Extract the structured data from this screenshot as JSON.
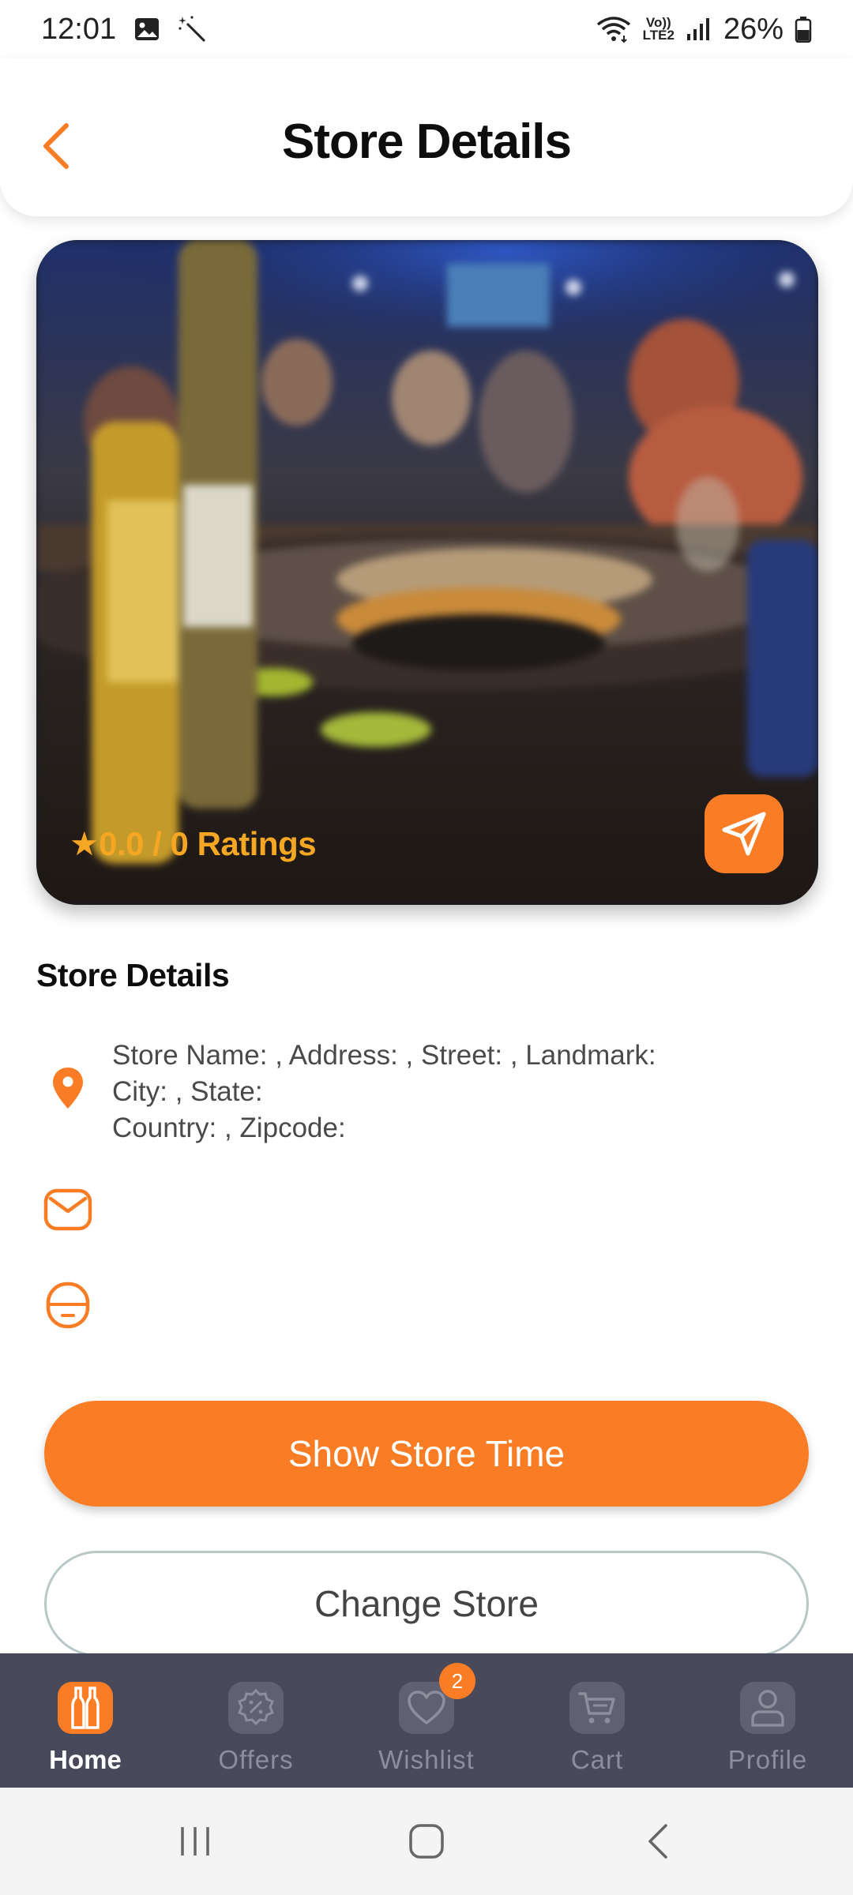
{
  "status_bar": {
    "time": "12:01",
    "volte_label_top": "Vo))",
    "volte_label_bottom": "LTE2",
    "battery": "26%",
    "icons": [
      "gallery-icon",
      "magic-wand-icon",
      "wifi-icon",
      "signal-icon",
      "battery-icon"
    ]
  },
  "header": {
    "title": "Store Details",
    "back_icon": "chevron-left-icon"
  },
  "hero": {
    "rating_text": "★0.0 / 0 Ratings",
    "share_icon": "send-icon"
  },
  "details": {
    "section_title": "Store Details",
    "address_lines": [
      "Store Name: , Address: , Street: , Landmark:",
      "City: , State:",
      "Country: , Zipcode:"
    ],
    "email": "",
    "phone": ""
  },
  "buttons": {
    "show_store_time": "Show Store Time",
    "change_store": "Change Store"
  },
  "bottom_nav": {
    "items": [
      {
        "label": "Home",
        "icon": "home-bottles-icon",
        "active": true
      },
      {
        "label": "Offers",
        "icon": "offers-badge-icon",
        "active": false
      },
      {
        "label": "Wishlist",
        "icon": "heart-icon",
        "active": false
      },
      {
        "label": "Cart",
        "icon": "cart-icon",
        "active": false,
        "badge": "2"
      },
      {
        "label": "Profile",
        "icon": "user-icon",
        "active": false
      }
    ]
  },
  "colors": {
    "accent": "#fa7d26",
    "rating": "#f5a623",
    "nav_background": "#484a5c",
    "text_dark": "#0d0d0d",
    "text_muted": "#4a4a4a"
  }
}
